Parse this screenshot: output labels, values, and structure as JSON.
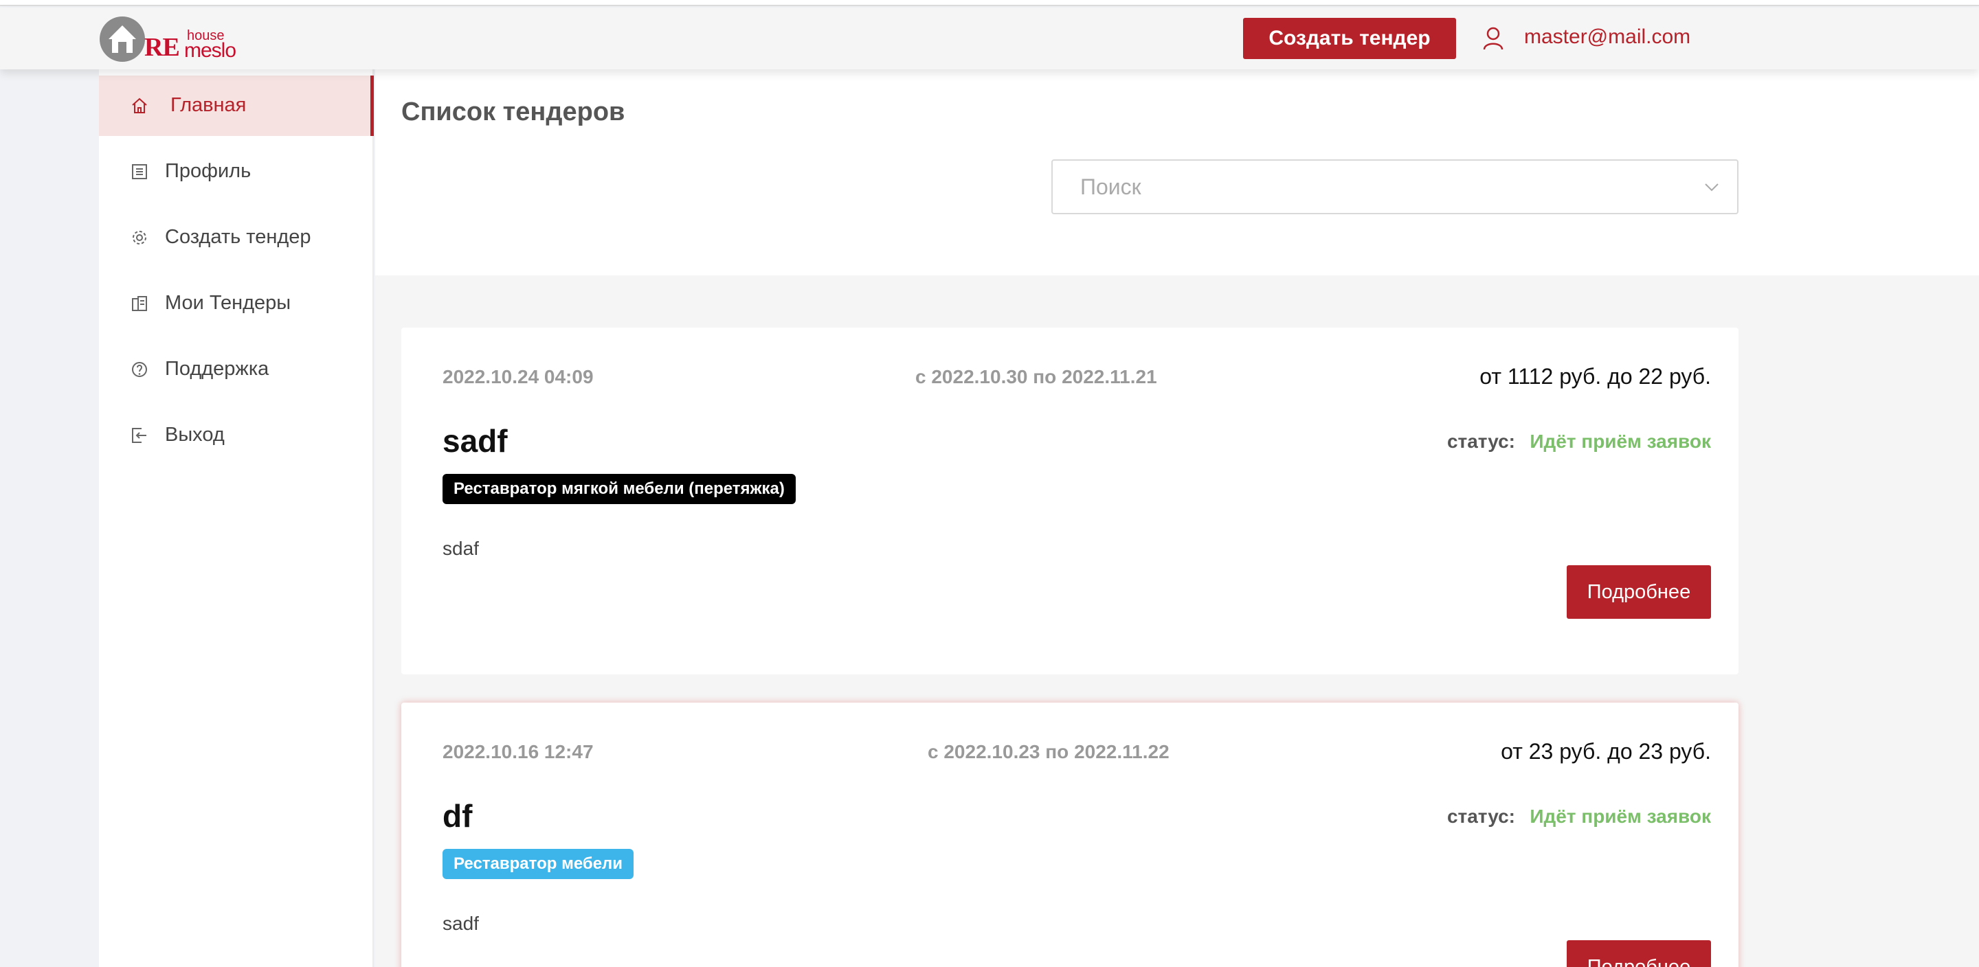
{
  "brand": {
    "re": "RE",
    "house": "house",
    "meslo": "meslo"
  },
  "header": {
    "create_button": "Создать тендер",
    "user_email": "master@mail.com"
  },
  "sidebar": {
    "items": [
      {
        "label": "Главная",
        "icon": "home-icon"
      },
      {
        "label": "Профиль",
        "icon": "profile-icon"
      },
      {
        "label": "Создать тендер",
        "icon": "gear-icon"
      },
      {
        "label": "Мои Тендеры",
        "icon": "tenders-icon"
      },
      {
        "label": "Поддержка",
        "icon": "help-icon"
      },
      {
        "label": "Выход",
        "icon": "logout-icon"
      }
    ]
  },
  "main": {
    "title": "Список тендеров",
    "search_placeholder": "Поиск",
    "tenders": [
      {
        "created": "2022.10.24 04:09",
        "period": "с 2022.10.30 по 2022.11.21",
        "price": "от 1112 руб. до 22 руб.",
        "title": "sadf",
        "status_label": "статус:",
        "status": "Идёт приём заявок",
        "tag": "Реставратор мягкой мебели (перетяжка)",
        "tag_color": "#000000",
        "description": "sdaf",
        "button": "Подробнее"
      },
      {
        "created": "2022.10.16 12:47",
        "period": "с 2022.10.23 по 2022.11.22",
        "price": "от 23 руб. до 23 руб.",
        "title": "df",
        "status_label": "статус:",
        "status": "Идёт приём заявок",
        "tag": "Реставратор мебели",
        "tag_color": "#3db5ea",
        "description": "sadf",
        "button": "Подробнее"
      }
    ]
  },
  "colors": {
    "accent": "#b5222a",
    "status_green": "#7cbf6b",
    "active_bg": "#f6e3e1"
  }
}
